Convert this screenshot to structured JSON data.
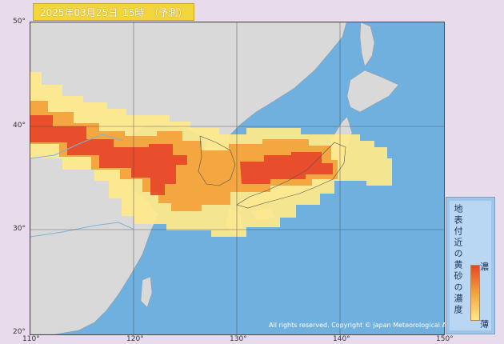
{
  "title": {
    "date": "2025年03月25日",
    "time": "15時",
    "mode": "（予測）"
  },
  "axes": {
    "lat_ticks": [
      "50°",
      "40°",
      "30°",
      "20°"
    ],
    "lon_ticks": [
      "110°",
      "120°",
      "130°",
      "140°",
      "150°"
    ]
  },
  "legend": {
    "label": "地表付近の黄砂の濃度",
    "high": "濃",
    "low": "薄"
  },
  "copyright": "All rights reserved. Copyright © Japan Meteorological Agency",
  "colors": {
    "sea": "#6fb0de",
    "land": "#d9d9d9",
    "dust_low": "#ffe98a",
    "dust_mid": "#f3a23c",
    "dust_high": "#e8452a"
  }
}
